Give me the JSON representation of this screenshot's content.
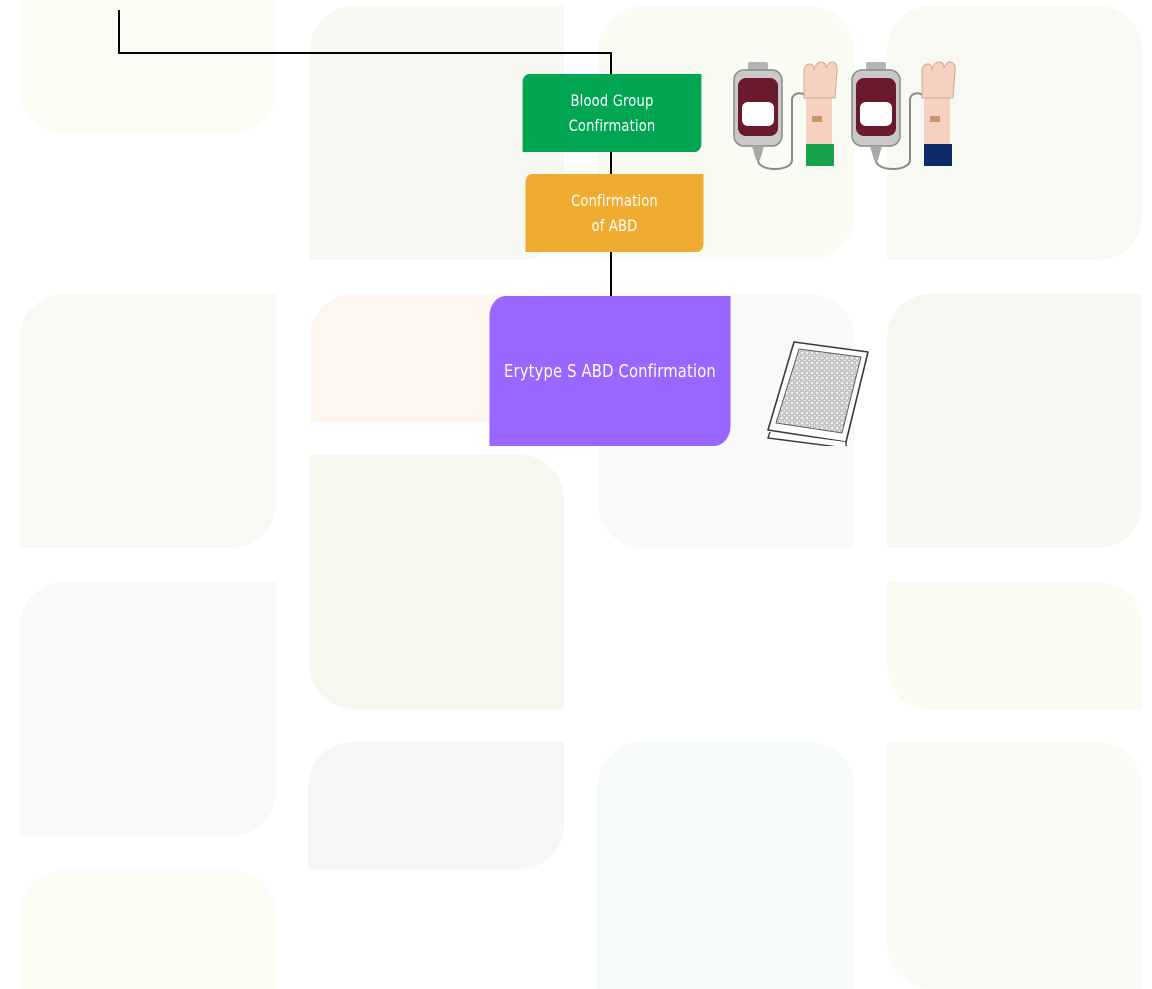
{
  "background": {
    "tile_colors": [
      "#fbfcf4",
      "#f7f8f2",
      "#fafbf3",
      "#f8f9f3",
      "#fdf7f0",
      "#f5f8ee",
      "#f7f9fb",
      "#fcfbf2",
      "#f6f6f6",
      "#f6fafa"
    ]
  },
  "flow": {
    "nodes": [
      {
        "label": "Blood Group\nConfirmation",
        "color": "#00a651"
      },
      {
        "label": "Confirmation\nof ABD",
        "color": "#f0ab31"
      },
      {
        "label": "Erytype S ABD Confirmation",
        "color": "#9966ff"
      }
    ]
  },
  "illustrations": {
    "blood_bag_color": "#6b1a2e",
    "sleeve_colors": [
      "#16a34a",
      "#0b2a66"
    ]
  }
}
